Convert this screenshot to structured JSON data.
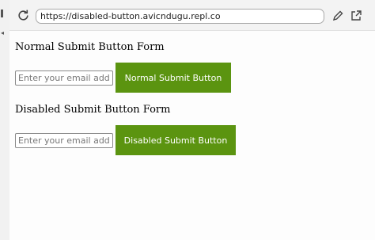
{
  "browser": {
    "url": "https://disabled-button.avicndugu.repl.co"
  },
  "normal_form": {
    "heading": "Normal Submit Button Form",
    "email_placeholder": "Enter your email address",
    "button_label": "Normal Submit Button"
  },
  "disabled_form": {
    "heading": "Disabled Submit Button Form",
    "email_placeholder": "Enter your email address",
    "button_label": "Disabled Submit Button"
  },
  "colors": {
    "button_bg": "#5b9410",
    "button_text": "#ffffff"
  },
  "icons": [
    "reload-icon",
    "edit-icon",
    "open-in-new-tab-icon"
  ]
}
